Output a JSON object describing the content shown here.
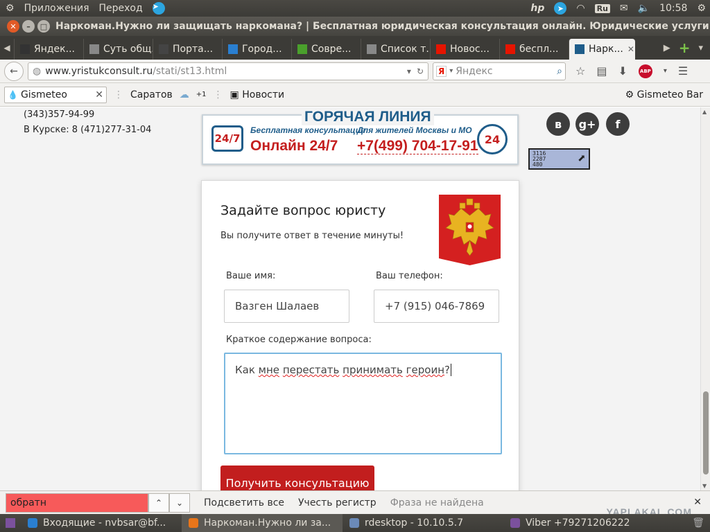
{
  "top_panel": {
    "apps": "Приложения",
    "go": "Переход",
    "layout": "Ru",
    "time": "10:58"
  },
  "window": {
    "title": "Наркоман.Нужно ли защищать наркомана? | Бесплатная юридическая консультация онлайн. Юридические услуги: адвокатс"
  },
  "tabs": [
    {
      "label": "Яндек...",
      "fav_color": "#333"
    },
    {
      "label": "Суть общ...",
      "fav_color": "#888"
    },
    {
      "label": "Порта...",
      "fav_color": "#444"
    },
    {
      "label": "Город...",
      "fav_color": "#2a7fd0"
    },
    {
      "label": "Совре...",
      "fav_color": "#4aa02c"
    },
    {
      "label": "Список т...",
      "fav_color": "#888"
    },
    {
      "label": "Новос...",
      "fav_color": "#e61400"
    },
    {
      "label": "беспл...",
      "fav_color": "#e61400"
    },
    {
      "label": "Нарк...",
      "fav_color": "#1f5d8a",
      "active": true
    }
  ],
  "nav": {
    "url_host": "www.yristukconsult.ru",
    "url_path": "/stati/st13.html",
    "search_placeholder": "Яндекс",
    "search_logo": "Я"
  },
  "bookmarks": {
    "gismeteo": "Gismeteo",
    "city": "Саратов",
    "temp_delta": "+1",
    "news": "Новости",
    "gismeteo_bar": "Gismeteo Bar"
  },
  "page": {
    "contacts": [
      "(343)357-94-99",
      "В Курске: 8 (471)277-31-04"
    ],
    "hotline": {
      "title": "ГОРЯЧАЯ ЛИНИЯ",
      "badge_247": "24/7",
      "free_label": "Бесплатная консультация",
      "online": "Онлайн 24/7",
      "residents_label": "Для жителей Москвы и МО",
      "phone": "+7(499) 704-17-91",
      "badge_24": "24"
    },
    "social": {
      "vk": "в",
      "gplus": "g+",
      "fb": "f"
    },
    "counter": [
      "3116",
      "2287",
      "480"
    ],
    "form": {
      "title": "Задайте вопрос юристу",
      "subtitle": "Вы получите ответ в течение минуты!",
      "name_label": "Ваше имя:",
      "name_value": "Вазген Шалаев",
      "phone_label": "Ваш телефон:",
      "phone_value": "+7 (915) 046-7869",
      "question_label": "Краткое содержание вопроса:",
      "question_parts": [
        "Как ",
        "мне",
        " ",
        "перестать",
        " ",
        "принимать",
        " ",
        "героин",
        "?"
      ],
      "submit": "Получить консультацию"
    }
  },
  "find_bar": {
    "query": "обратн",
    "highlight": "Подсветить все",
    "match_case": "Учесть регистр",
    "status": "Фраза не найдена",
    "watermark": "YAPLAKAL.COM"
  },
  "taskbar": [
    {
      "label": "Входящие - nvbsar@bf...",
      "icon_color": "#2a7fd0"
    },
    {
      "label": "Наркоман.Нужно ли за...",
      "icon_color": "#e8751a",
      "active": true
    },
    {
      "label": "rdesktop - 10.10.5.7",
      "icon_color": "#6b8ab8"
    },
    {
      "label": "Viber +79271206222",
      "icon_color": "#7b519d"
    }
  ]
}
